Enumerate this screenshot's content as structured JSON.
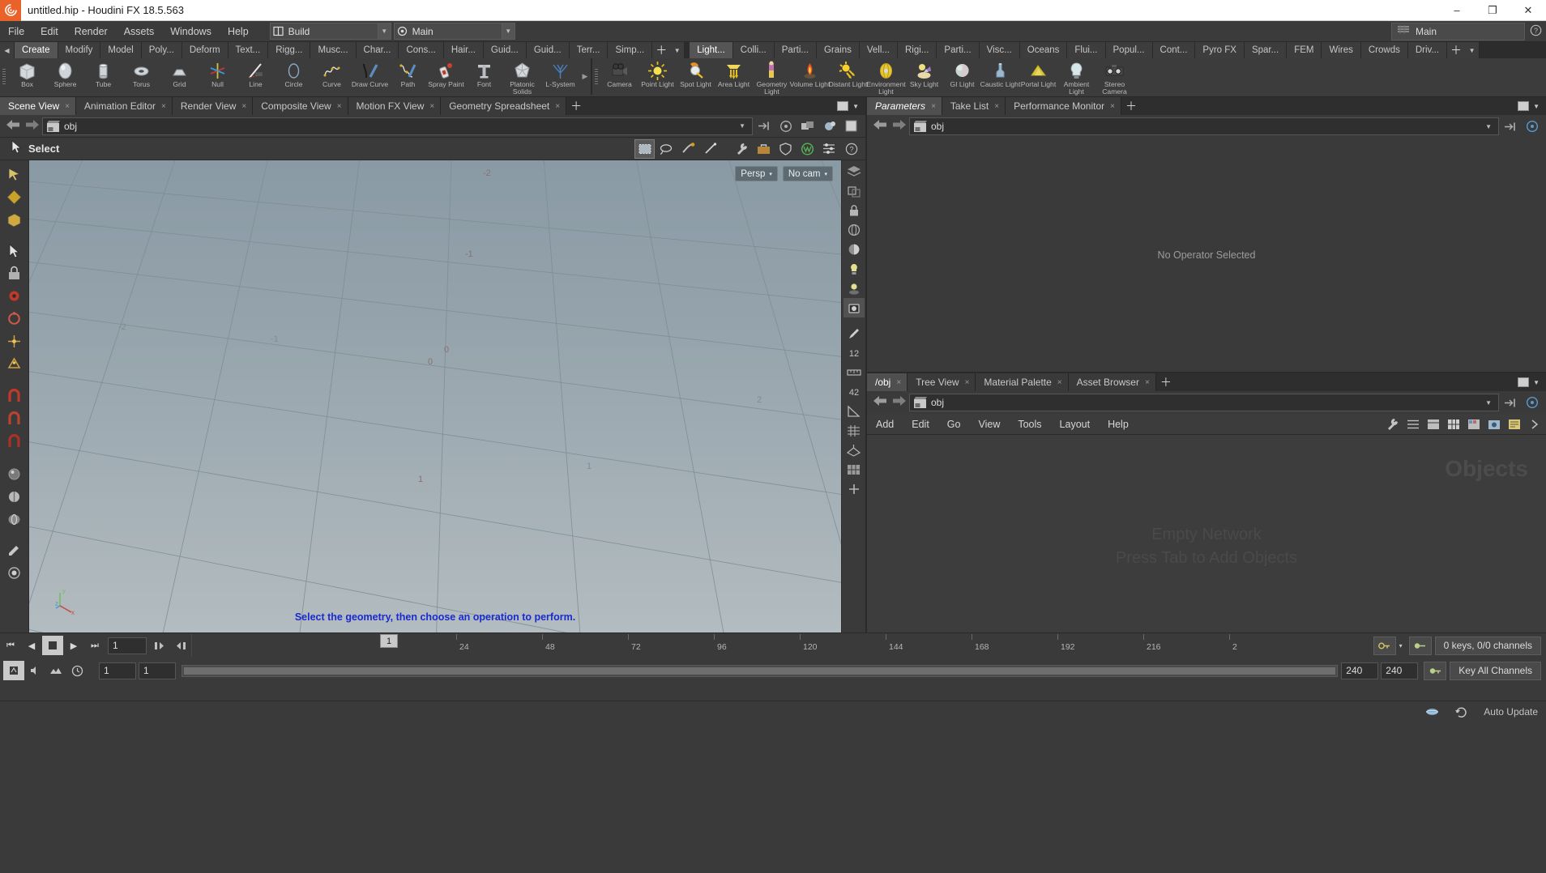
{
  "window": {
    "title": "untitled.hip - Houdini FX 18.5.563",
    "app_icon": "houdini-logo-icon",
    "minimize": "–",
    "maximize": "❐",
    "close": "✕"
  },
  "menubar": {
    "items": [
      "File",
      "Edit",
      "Render",
      "Assets",
      "Windows",
      "Help"
    ],
    "build_selector": {
      "label": "Build",
      "icon": "build-icon",
      "arrow": "▼"
    },
    "main_selector": {
      "label": "Main",
      "icon": "target-icon",
      "arrow": "▼"
    },
    "desktop": {
      "label": "Main",
      "icon": "desktop-icon"
    },
    "help_icon": "question-circle-icon"
  },
  "shelf": {
    "left_tabs": [
      "Create",
      "Modify",
      "Model",
      "Poly...",
      "Deform",
      "Text...",
      "Rigg...",
      "Musc...",
      "Char...",
      "Cons...",
      "Hair...",
      "Guid...",
      "Guid...",
      "Terr...",
      "Simp..."
    ],
    "left_active": "Create",
    "left_plus": "＋",
    "left_arrow": "▼",
    "right_tabs": [
      "Light...",
      "Colli...",
      "Parti...",
      "Grains",
      "Vell...",
      "Rigi...",
      "Parti...",
      "Visc...",
      "Oceans",
      "Flui...",
      "Popul...",
      "Cont...",
      "Pyro FX",
      "Spar...",
      "FEM",
      "Wires",
      "Crowds",
      "Driv..."
    ],
    "right_active": "Light...",
    "right_plus": "＋",
    "left_tools": [
      {
        "label": "Box",
        "icon": "box-icon"
      },
      {
        "label": "Sphere",
        "icon": "sphere-icon"
      },
      {
        "label": "Tube",
        "icon": "tube-icon"
      },
      {
        "label": "Torus",
        "icon": "torus-icon"
      },
      {
        "label": "Grid",
        "icon": "grid-icon"
      },
      {
        "label": "Null",
        "icon": "null-icon"
      },
      {
        "label": "Line",
        "icon": "line-icon"
      },
      {
        "label": "Circle",
        "icon": "circle-icon"
      },
      {
        "label": "Curve",
        "icon": "curve-icon"
      },
      {
        "label": "Draw Curve",
        "icon": "draw-curve-icon"
      },
      {
        "label": "Path",
        "icon": "path-icon"
      },
      {
        "label": "Spray Paint",
        "icon": "spray-paint-icon"
      },
      {
        "label": "Font",
        "icon": "font-icon"
      },
      {
        "label": "Platonic Solids",
        "icon": "platonic-solids-icon"
      },
      {
        "label": "L-System",
        "icon": "l-system-icon"
      }
    ],
    "right_tools": [
      {
        "label": "Camera",
        "icon": "camera-icon"
      },
      {
        "label": "Point Light",
        "icon": "point-light-icon"
      },
      {
        "label": "Spot Light",
        "icon": "spot-light-icon"
      },
      {
        "label": "Area Light",
        "icon": "area-light-icon"
      },
      {
        "label": "Geometry Light",
        "icon": "geometry-light-icon"
      },
      {
        "label": "Volume Light",
        "icon": "volume-light-icon"
      },
      {
        "label": "Distant Light",
        "icon": "distant-light-icon"
      },
      {
        "label": "Environment Light",
        "icon": "environment-light-icon"
      },
      {
        "label": "Sky Light",
        "icon": "sky-light-icon"
      },
      {
        "label": "GI Light",
        "icon": "gi-light-icon"
      },
      {
        "label": "Caustic Light",
        "icon": "caustic-light-icon"
      },
      {
        "label": "Portal Light",
        "icon": "portal-light-icon"
      },
      {
        "label": "Ambient Light",
        "icon": "ambient-light-icon"
      },
      {
        "label": "Stereo Camera",
        "icon": "stereo-camera-icon"
      }
    ]
  },
  "left_pane": {
    "tabs": [
      {
        "label": "Scene View",
        "active": true
      },
      {
        "label": "Animation Editor",
        "active": false
      },
      {
        "label": "Render View",
        "active": false
      },
      {
        "label": "Composite View",
        "active": false
      },
      {
        "label": "Motion FX View",
        "active": false
      },
      {
        "label": "Geometry Spreadsheet",
        "active": false
      }
    ],
    "add_tab": "＋",
    "close_glyph": "×",
    "path": {
      "value": "obj",
      "icon": "obj-network-icon",
      "arrow": "▼",
      "back": "←",
      "forward": "→"
    },
    "viewport_toolbar": {
      "title": "Select",
      "cursor_icon": "arrow-cursor-icon",
      "tools": [
        {
          "name": "box-select-icon",
          "selected": true
        },
        {
          "name": "lasso-select-icon",
          "selected": false
        },
        {
          "name": "brush-select-icon",
          "selected": false
        },
        {
          "name": "laser-select-icon",
          "selected": false
        },
        {
          "name": "wrench-icon",
          "selected": false
        },
        {
          "name": "toolbox-icon",
          "selected": false
        },
        {
          "name": "shield-icon",
          "selected": false
        },
        {
          "name": "visibility-icon",
          "selected": false
        }
      ],
      "display_options_icon": "display-options-icon",
      "help_icon": "help-circle-icon"
    },
    "viewport": {
      "view_mode": "Persp",
      "view_mode_arrow": "▾",
      "camera": "No cam",
      "camera_arrow": "▾",
      "hint": "Select the geometry, then choose an operation to perform.",
      "axis_labels": [
        "z",
        "y",
        "x"
      ],
      "grid_numbers": [
        "-2",
        "-1",
        "0",
        "1",
        "2",
        "-2",
        "-1",
        "0",
        "1",
        "2"
      ]
    }
  },
  "right_pane": {
    "tabs": [
      {
        "label": "Parameters",
        "active": true,
        "italic": true
      },
      {
        "label": "Take List",
        "active": false,
        "italic": false
      },
      {
        "label": "Performance Monitor",
        "active": false,
        "italic": false
      }
    ],
    "add_tab": "＋",
    "close_glyph": "×",
    "path": {
      "value": "obj",
      "icon": "obj-network-icon",
      "arrow": "▼",
      "back": "←",
      "forward": "→"
    },
    "empty_message": "No Operator Selected"
  },
  "network_editor": {
    "tabs": [
      {
        "label": "/obj",
        "active": true
      },
      {
        "label": "Tree View",
        "active": false
      },
      {
        "label": "Material Palette",
        "active": false
      },
      {
        "label": "Asset Browser",
        "active": false
      }
    ],
    "add_tab": "＋",
    "close_glyph": "×",
    "path": {
      "value": "obj",
      "icon": "obj-network-icon",
      "arrow": "▼",
      "back": "←",
      "forward": "→"
    },
    "menu": [
      "Add",
      "Edit",
      "Go",
      "View",
      "Tools",
      "Layout",
      "Help"
    ],
    "menu_icons": [
      "wrench-icon",
      "list-icon",
      "align-icon",
      "grid-layout-icon",
      "color-palette-icon",
      "snapshot-icon",
      "notes-icon",
      "more-icon"
    ],
    "watermark": "Objects",
    "empty_line1": "Empty Network",
    "empty_line2": "Press Tab to Add Objects"
  },
  "playbar": {
    "transport": [
      {
        "name": "jump-start-button",
        "glyph": "⏮"
      },
      {
        "name": "step-back-button",
        "glyph": "◀"
      },
      {
        "name": "stop-button",
        "glyph": "■"
      },
      {
        "name": "play-button",
        "glyph": "▶"
      },
      {
        "name": "step-forward-button",
        "glyph": "⏭"
      },
      {
        "name": "jump-end-button",
        "glyph": "▶|"
      }
    ],
    "current_frame": "1",
    "playhead_frame": "1",
    "ruler_ticks": [
      "24",
      "48",
      "72",
      "96",
      "120",
      "144",
      "168",
      "192",
      "216",
      "2"
    ],
    "range_start": "1",
    "range_start2": "1",
    "range_end": "240",
    "range_end2": "240",
    "bottom_icons": [
      "key-mode-icon",
      "audio-icon",
      "snapshot-icon",
      "clock-icon",
      "prev-key-icon",
      "next-key-icon"
    ],
    "keys_status": "0 keys, 0/0 channels",
    "key_all_button": "Key All Channels",
    "key_icon_1": "key-icon",
    "key_icon_2": "key-channels-icon",
    "scope_arrow": "▾"
  },
  "statusbar": {
    "auto_update": "Auto Update",
    "icons": [
      "network-status-icon",
      "refresh-icon"
    ]
  },
  "colors": {
    "accent_orange": "#e8622a",
    "panel_bg": "#3a3a3a",
    "dark_bg": "#2c2c2c",
    "tab_active": "#555555",
    "hint_blue": "#1a2ad0",
    "viewport_top": "#8a9aa4",
    "viewport_bottom": "#b3bcc0"
  }
}
